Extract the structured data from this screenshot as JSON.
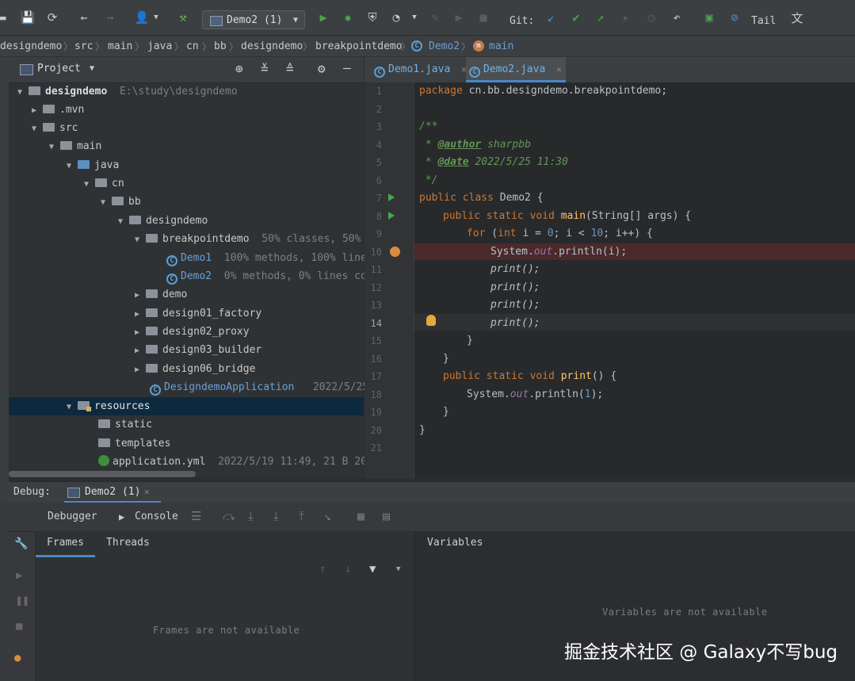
{
  "toolbar": {
    "run_config": "Demo2 (1)",
    "git_label": "Git:",
    "tail_label": "Tail",
    "icons": [
      "save-icon",
      "sync-icon",
      "back-icon",
      "forward-icon",
      "user-icon",
      "build-hammer-icon",
      "run-icon",
      "debug-bug-icon",
      "coverage-icon",
      "profile-icon",
      "attach-icon",
      "resume-icon",
      "stop-icon",
      "git-update-icon",
      "git-commit-icon",
      "git-push-icon",
      "git-history-icon",
      "revert-icon",
      "monitor-icon",
      "no-entry-icon",
      "translate-icon"
    ]
  },
  "breadcrumb": [
    "designdemo",
    "src",
    "main",
    "java",
    "cn",
    "bb",
    "designdemo",
    "breakpointdemo",
    "Demo2",
    "main"
  ],
  "project": {
    "title": "Project",
    "tree": [
      {
        "label": "designdemo",
        "hint": "E:\\study\\designdemo"
      },
      {
        "label": ".mvn"
      },
      {
        "label": "src"
      },
      {
        "label": "main"
      },
      {
        "label": "java"
      },
      {
        "label": "cn"
      },
      {
        "label": "bb"
      },
      {
        "label": "designdemo"
      },
      {
        "label": "breakpointdemo",
        "hint": "50% classes, 50% l"
      },
      {
        "label": "Demo1",
        "hint": "100% methods, 100% lines"
      },
      {
        "label": "Demo2",
        "hint": "0% methods, 0% lines cov"
      },
      {
        "label": "demo"
      },
      {
        "label": "design01_factory"
      },
      {
        "label": "design02_proxy"
      },
      {
        "label": "design03_builder"
      },
      {
        "label": "design06_bridge"
      },
      {
        "label": "DesigndemoApplication",
        "hint": "2022/5/25"
      },
      {
        "label": "resources"
      },
      {
        "label": "static"
      },
      {
        "label": "templates"
      },
      {
        "label": "application.yml",
        "hint": "2022/5/19 11:49, 21 B 202"
      }
    ]
  },
  "editor": {
    "tabs": [
      {
        "label": "Demo1.java"
      },
      {
        "label": "Demo2.java"
      }
    ],
    "line_numbers": [
      "1",
      "2",
      "3",
      "4",
      "5",
      "6",
      "7",
      "8",
      "9",
      "10",
      "11",
      "12",
      "13",
      "14",
      "15",
      "16",
      "17",
      "18",
      "19",
      "20",
      "21"
    ],
    "code": {
      "l1_kw": "package",
      "l1_rest": " cn.bb.designdemo.breakpointdemo;",
      "l3": "/**",
      "l4_pre": " * ",
      "l4_tag": "@author",
      "l4_val": " sharpbb",
      "l5_pre": " * ",
      "l5_tag": "@date",
      "l5_val": " 2022/5/25 11:30",
      "l6": " */",
      "l7_kw": "public class",
      "l7_rest": " Demo2 {",
      "l8_kw": "public static void",
      "l8_fn": " main",
      "l8_rest": "(String[] args) {",
      "l9_kw": "for",
      "l9_a": " (",
      "l9_int": "int",
      "l9_b": " i = ",
      "l9_n0": "0",
      "l9_c": "; i < ",
      "l9_n10": "10",
      "l9_d": "; i++) {",
      "l10_a": "System.",
      "l10_out": "out",
      "l10_b": ".println(i);",
      "print_call": "print();",
      "l15": "}",
      "l16": "}",
      "l17_kw": "public static void",
      "l17_fn": " print",
      "l17_rest": "() {",
      "l18_a": "System.",
      "l18_out": "out",
      "l18_b": ".println(",
      "l18_n": "1",
      "l18_c": ");",
      "l19": "}",
      "l20": "}"
    }
  },
  "debug": {
    "label": "Debug:",
    "session_tab": "Demo2 (1)",
    "debugger_tab": "Debugger",
    "console_tab": "Console",
    "frames_tab": "Frames",
    "threads_tab": "Threads",
    "variables_title": "Variables",
    "frames_empty": "Frames are not available",
    "variables_empty": "Variables are not available"
  },
  "watermark": "掘金技术社区 @ Galaxy不写bug",
  "colors": {
    "accent": "#4a88c7",
    "keyword": "#cc7832",
    "comment": "#629755",
    "breakpoint": "#d98a3d"
  }
}
